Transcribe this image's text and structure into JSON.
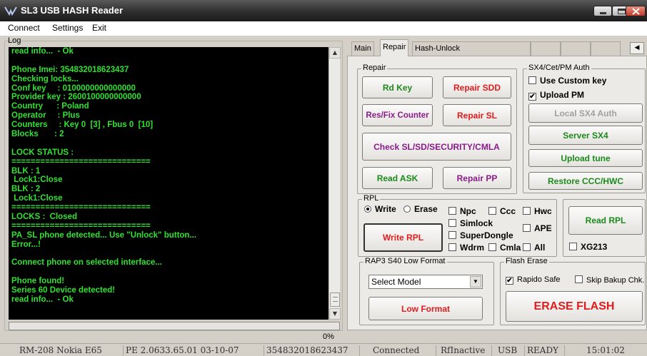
{
  "window": {
    "title": "SL3 USB HASH Reader"
  },
  "menu": [
    "Connect",
    "Settings",
    "Exit"
  ],
  "log": {
    "label": "Log",
    "lines": [
      "read info...  - Ok",
      "",
      "Phone Imei: 354832018623437",
      "Checking locks...",
      "Conf key     : 0100000000000000",
      "Provider key : 2600100000000000",
      "Country      : Poland",
      "Operator     : Plus",
      "Counters     : Key 0  [3] , Fbus 0  [10]",
      "Blocks       : 2",
      "",
      "LOCK STATUS :",
      "=============================",
      "BLK : 1",
      " Lock1:Close",
      "BLK : 2",
      " Lock1:Close",
      "=============================",
      "LOCKS :  Closed",
      "=============================",
      "PA_SL phone detected... Use \"Unlock\" button...",
      "Error...!",
      "",
      "Connect phone on selected interface...",
      "",
      "Phone found!",
      "Series 60 Device detected!",
      "read info...  - Ok"
    ]
  },
  "tabs": [
    "Main",
    "Repair",
    "Hash-Unlock"
  ],
  "active_tab": "Repair",
  "repair": {
    "label": "Repair",
    "rd_key": "Rd Key",
    "repair_sdd": "Repair SDD",
    "res_fix_counter": "Res/Fix Counter",
    "repair_sl": "Repair SL",
    "check_sl": "Check SL/SD/SECURITY/CMLA",
    "read_ask": "Read ASK",
    "repair_pp": "Repair PP"
  },
  "sx4": {
    "label": "SX4/Cet/PM Auth",
    "use_custom_key": "Use Custom key",
    "use_custom_key_checked": false,
    "upload_pm": "Upload PM",
    "upload_pm_checked": true,
    "local_sx4": "Local SX4 Auth",
    "server_sx4": "Server SX4",
    "upload_tune": "Upload tune",
    "restore_ccc": "Restore CCC/HWC"
  },
  "rpl": {
    "label": "RPL",
    "write": "Write",
    "erase": "Erase",
    "selected_mode": "Write",
    "npc": "Npc",
    "ccc": "Ccc",
    "hwc": "Hwc",
    "simlock": "Simlock",
    "ape": "APE",
    "superdongle": "SuperDongle",
    "wdrm": "Wdrm",
    "cmla": "Cmla",
    "all": "All",
    "write_rpl": "Write RPL",
    "read_rpl": "Read RPL",
    "xg213": "XG213"
  },
  "rap3": {
    "label": "RAP3 S40 Low Format",
    "select_model": "Select Model",
    "low_format": "Low Format"
  },
  "flash_erase": {
    "label": "Flash Erase",
    "rapido_safe": "Rapido Safe",
    "rapido_safe_checked": true,
    "skip_bakup": "Skip Bakup Chk.",
    "skip_bakup_checked": false,
    "erase_flash": "ERASE FLASH"
  },
  "progress": {
    "text": "0%",
    "value": 0
  },
  "status": {
    "model": "RM-208 Nokia E65",
    "firmware": "PE  2.0633.65.01 03-10-07",
    "imei": "354832018623437",
    "connection": "Connected",
    "rf": "RfInactive",
    "interface": "USB",
    "state": "READY",
    "time": "15:01:02"
  },
  "colors": {
    "log_text": "#2fe22f",
    "green_btn": "#1b8a1b",
    "red_btn": "#e01c1c",
    "purple_btn": "#8a1c8a"
  }
}
